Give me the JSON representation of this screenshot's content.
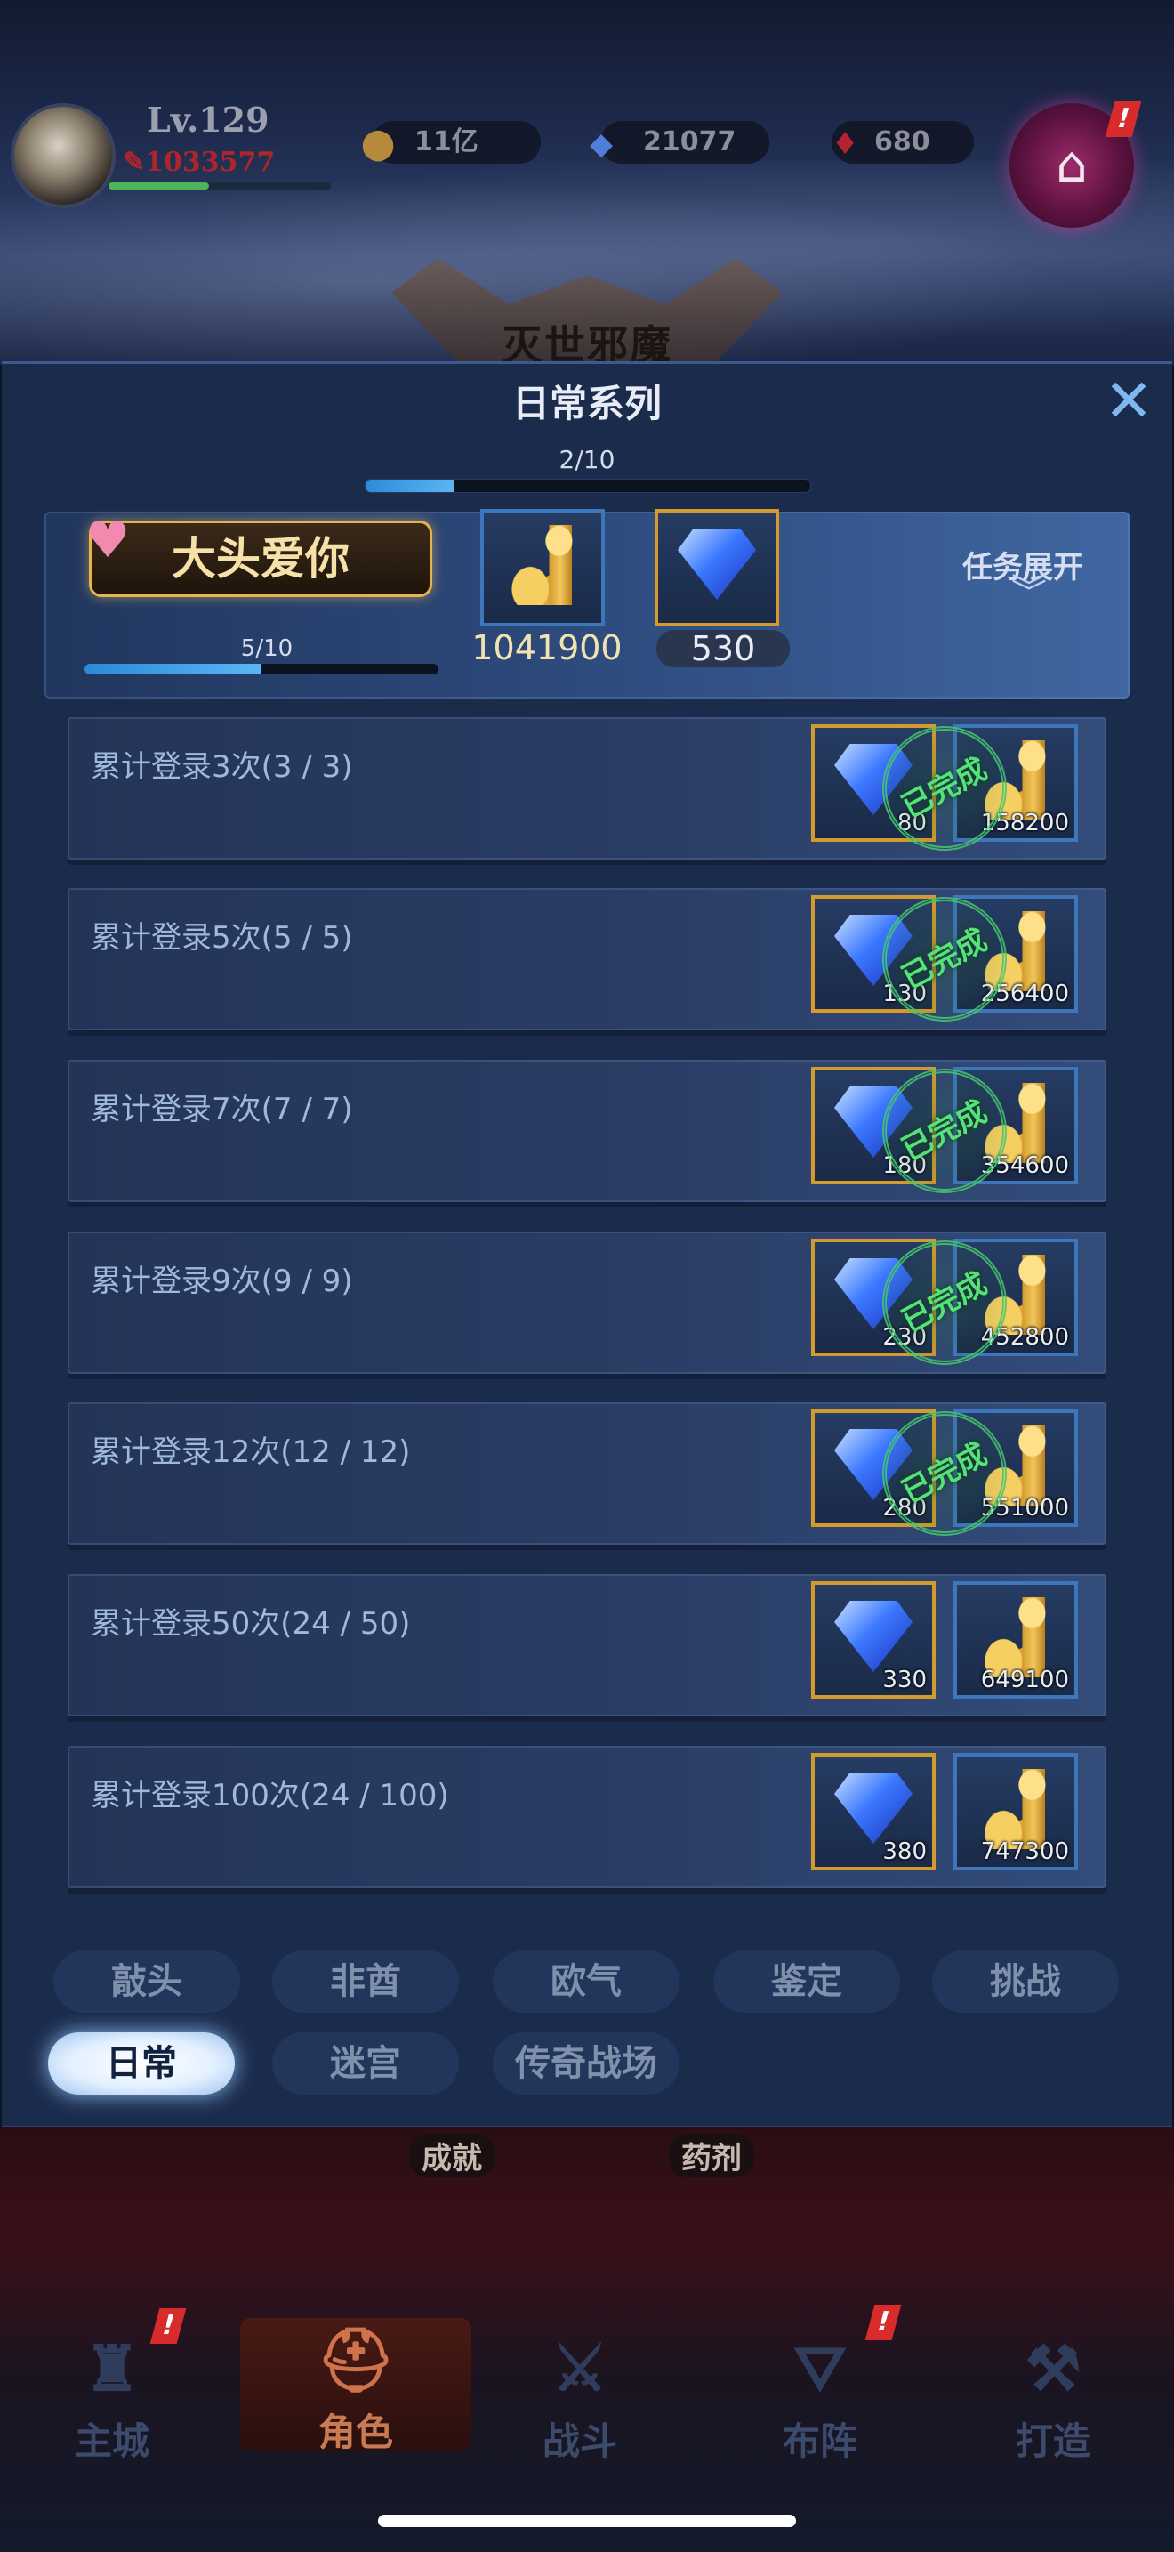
{
  "hud": {
    "level": "Lv.129",
    "power": "1033577",
    "power_progress": 0.45,
    "gold": "11亿",
    "diamonds": "21077",
    "rubies": "680",
    "scroll_badge": "!"
  },
  "scene": {
    "emblem_text": "灭世邪魔"
  },
  "panel": {
    "title": "日常系列",
    "close_icon": "✕",
    "series_progress_text": "2/10",
    "series_progress": 0.2
  },
  "featured": {
    "title": "大头爱你",
    "progress_text": "5/10",
    "progress": 0.5,
    "gold_reward": "1041900",
    "diamond_reward": "530",
    "expand_label": "任务展开",
    "expand_icon": "chevron-double-down-icon"
  },
  "tasks": [
    {
      "label": "累计登录3次(3 / 3)",
      "diamond": "80",
      "gold": "158200",
      "completed": true,
      "stamp": "已完成"
    },
    {
      "label": "累计登录5次(5 / 5)",
      "diamond": "130",
      "gold": "256400",
      "completed": true,
      "stamp": "已完成"
    },
    {
      "label": "累计登录7次(7 / 7)",
      "diamond": "180",
      "gold": "354600",
      "completed": true,
      "stamp": "已完成"
    },
    {
      "label": "累计登录9次(9 / 9)",
      "diamond": "230",
      "gold": "452800",
      "completed": true,
      "stamp": "已完成"
    },
    {
      "label": "累计登录12次(12 / 12)",
      "diamond": "280",
      "gold": "551000",
      "completed": true,
      "stamp": "已完成"
    },
    {
      "label": "累计登录50次(24 / 50)",
      "diamond": "330",
      "gold": "649100",
      "completed": false
    },
    {
      "label": "累计登录100次(24 / 100)",
      "diamond": "380",
      "gold": "747300",
      "completed": false
    }
  ],
  "tabs": {
    "row1": [
      "敲头",
      "非酋",
      "欧气",
      "鉴定",
      "挑战"
    ],
    "row2": [
      "日常",
      "迷宫",
      "传奇战场"
    ],
    "active": "日常"
  },
  "lower": {
    "sub_buttons": [
      "成就",
      "药剂"
    ],
    "nav": [
      "主城",
      "角色",
      "战斗",
      "布阵",
      "打造"
    ],
    "active_nav": "角色",
    "badges": [
      "!",
      "!"
    ]
  },
  "colors": {
    "panel_bg": "#1b2b4c",
    "progress_fill": "#5ab6f4",
    "gold_border": "#d39a2c",
    "blue_border": "#3e76bb",
    "complete_stamp": "#56e27a",
    "power_red": "#b0252b"
  }
}
